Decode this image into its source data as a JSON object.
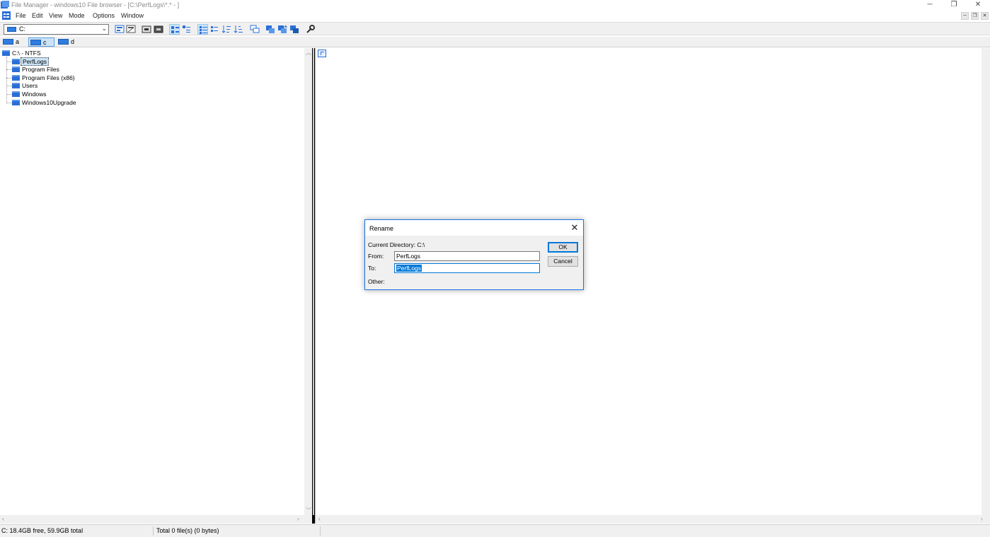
{
  "window": {
    "title": "File Manager - windows10 File browser - [C:\\PerfLogs\\*.* - ]",
    "controls": {
      "minimize": "─",
      "restore": "❐",
      "close": "✕"
    }
  },
  "menu": {
    "items": [
      "File",
      "Edit",
      "View",
      "Mode",
      "Options",
      "Window"
    ],
    "mdi_controls": {
      "minimize": "─",
      "restore": "❐",
      "close": "✕"
    }
  },
  "toolbar": {
    "drive_select_value": "C:",
    "buttons": [
      "connect-net-icon",
      "disconnect-net-icon",
      "share-icon",
      "stop-share-icon",
      "tree-dir-icon",
      "tree-only-icon",
      "name-view-icon",
      "sort-name-icon",
      "sort-type-icon",
      "sort-size-icon",
      "new-window-icon",
      "copy-icon",
      "move-icon",
      "delete-icon",
      "options-wrench-icon"
    ]
  },
  "drives": [
    {
      "label": "a",
      "active": false
    },
    {
      "label": "c",
      "active": true
    },
    {
      "label": "d",
      "active": false
    }
  ],
  "tree": {
    "root": "C:\\ - NTFS",
    "folders": [
      "PerfLogs",
      "Program Files",
      "Program Files (x86)",
      "Users",
      "Windows",
      "Windows10Upgrade"
    ],
    "selected": "PerfLogs"
  },
  "status": {
    "disk": "C: 18.4GB free,  59.9GB total",
    "files": "Total 0 file(s) (0 bytes)"
  },
  "dialog": {
    "title": "Rename",
    "close": "✕",
    "current_directory": "Current Directory: C:\\",
    "from_label": "From:",
    "from_value": "PerfLogs",
    "to_label": "To:",
    "to_value": "PerfLogs",
    "other_label": "Other:",
    "ok": "OK",
    "cancel": "Cancel"
  },
  "colors": {
    "accent": "#0078d7",
    "folder": "#2b6fd6",
    "dialog_border": "#1a73e8"
  }
}
